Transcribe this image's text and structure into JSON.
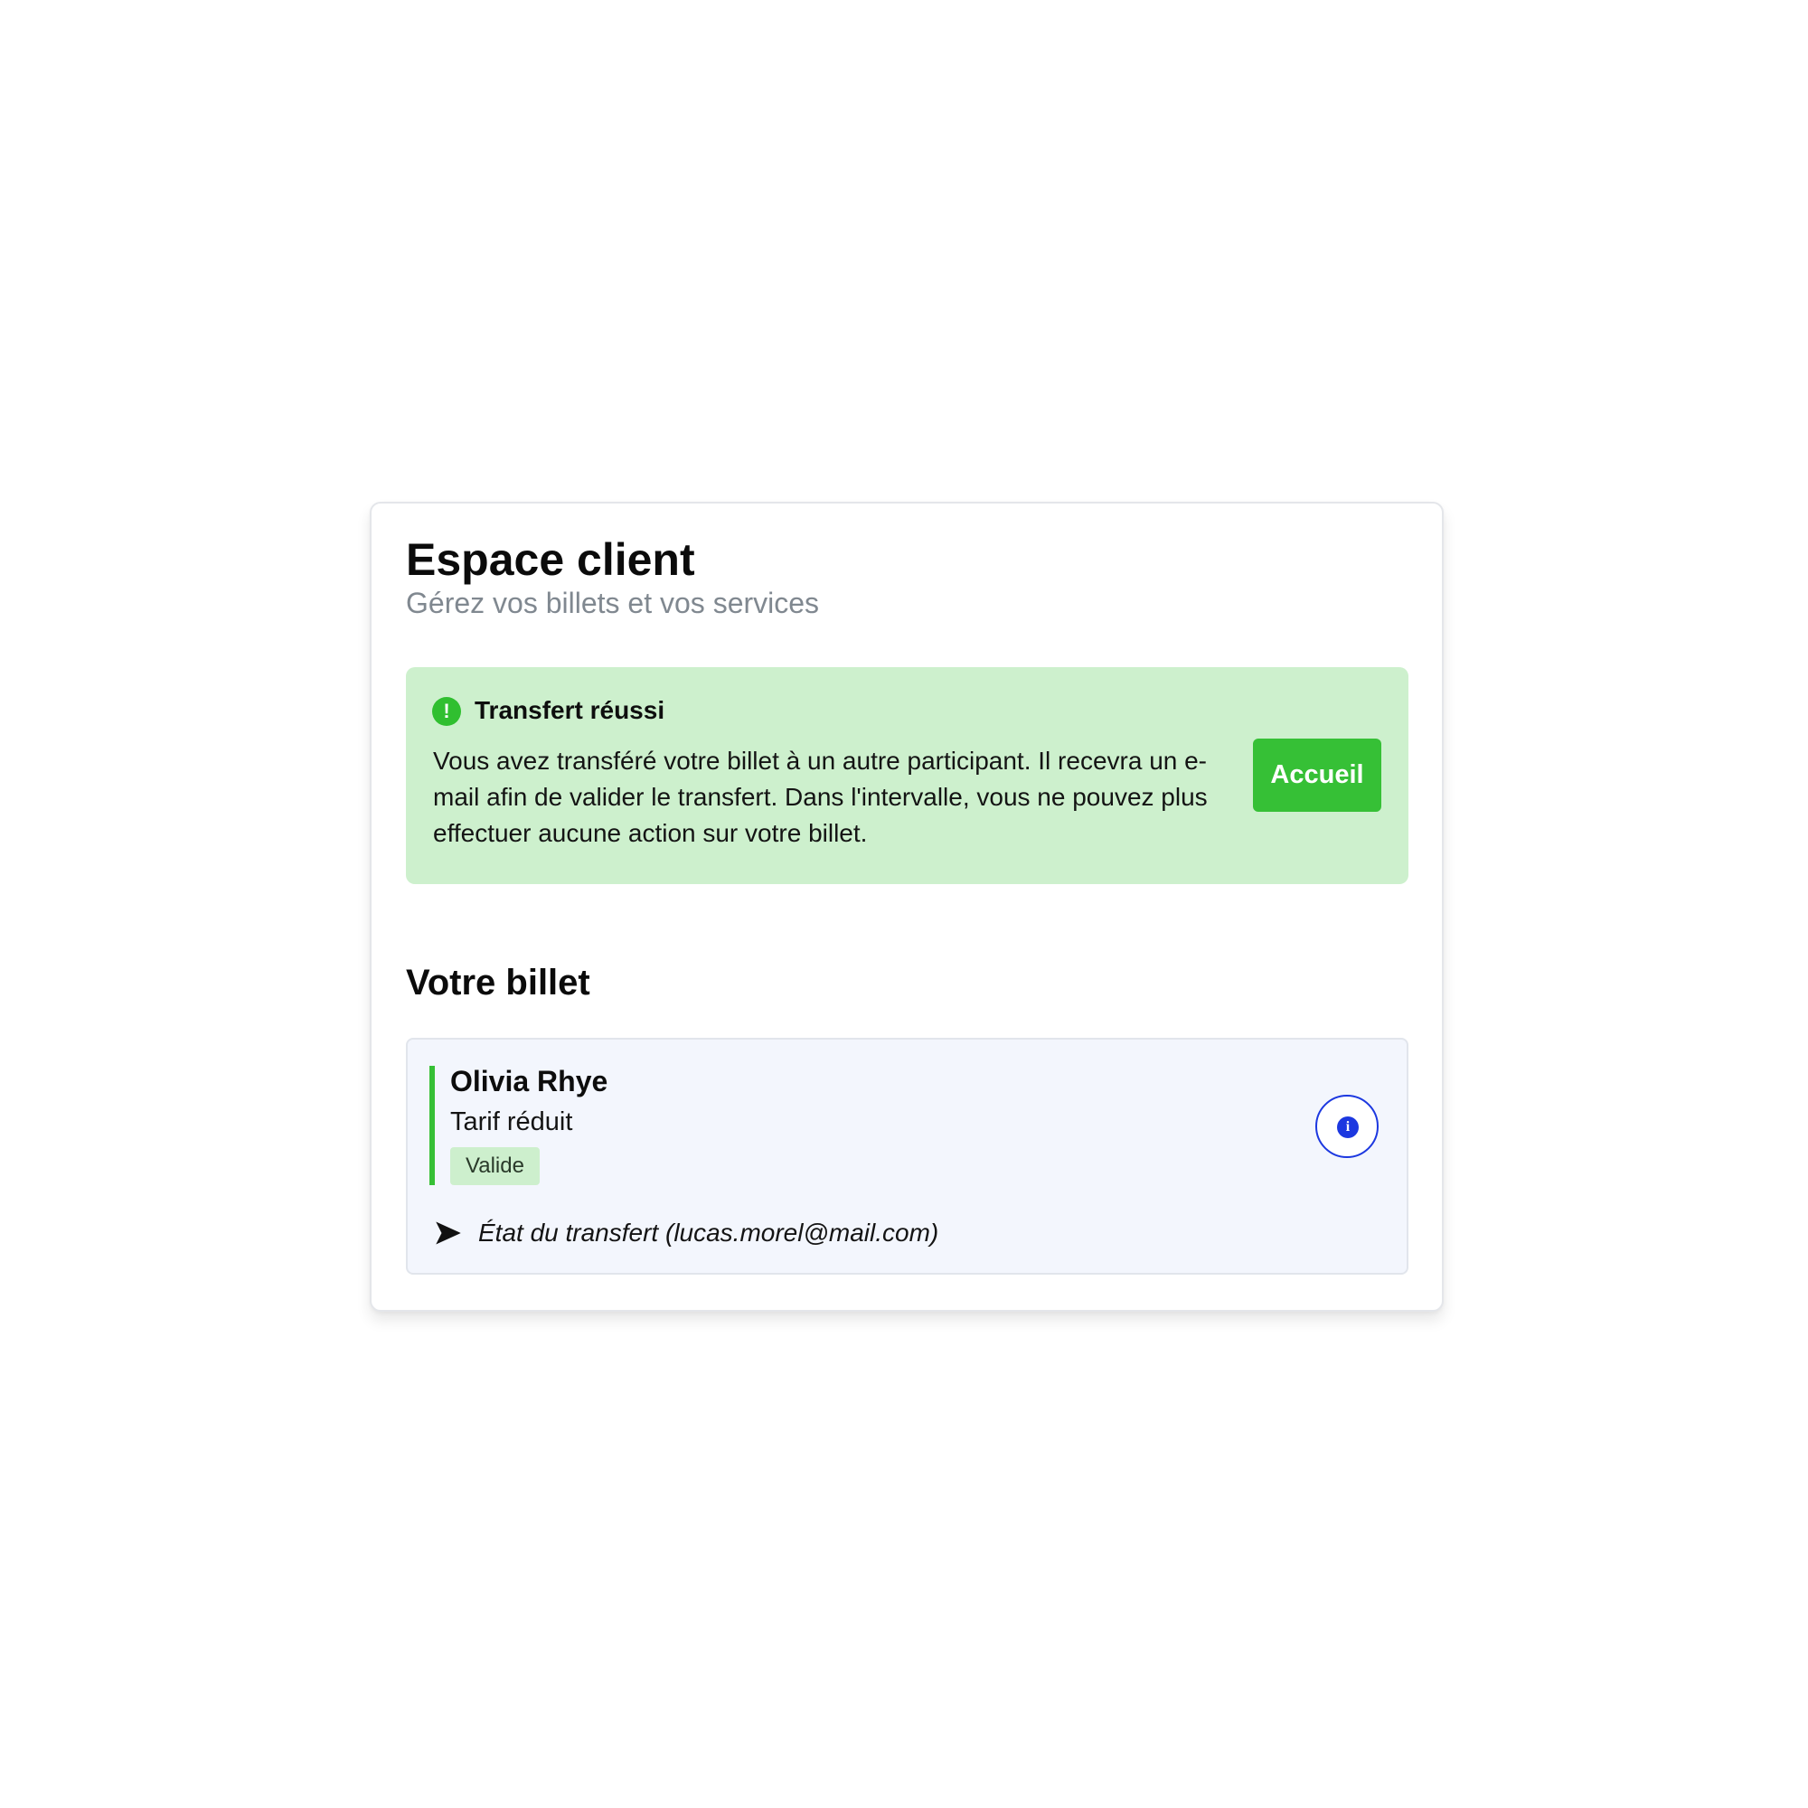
{
  "header": {
    "title": "Espace client",
    "subtitle": "Gérez vos billets et vos services"
  },
  "alert": {
    "icon": "alert-circle-icon",
    "icon_glyph": "!",
    "title": "Transfert réussi",
    "message": "Vous avez transféré votre billet à un autre participant. Il recevra un e-mail afin de valider le transfert. Dans l'intervalle, vous ne pouvez plus effectuer aucune action sur votre billet.",
    "button_label": "Accueil",
    "colors": {
      "background": "#cdf0cd",
      "accent": "#36c036"
    }
  },
  "ticket_section": {
    "title": "Votre billet",
    "ticket": {
      "holder_name": "Olivia Rhye",
      "fare": "Tarif réduit",
      "status": "Valide",
      "info_icon": "info-icon",
      "info_glyph": "i",
      "transfer_icon": "send-icon",
      "transfer_status": "État du transfert (lucas.morel@mail.com)",
      "colors": {
        "accent": "#36c036",
        "info": "#1c38e0",
        "background": "#f3f6fd"
      }
    }
  }
}
